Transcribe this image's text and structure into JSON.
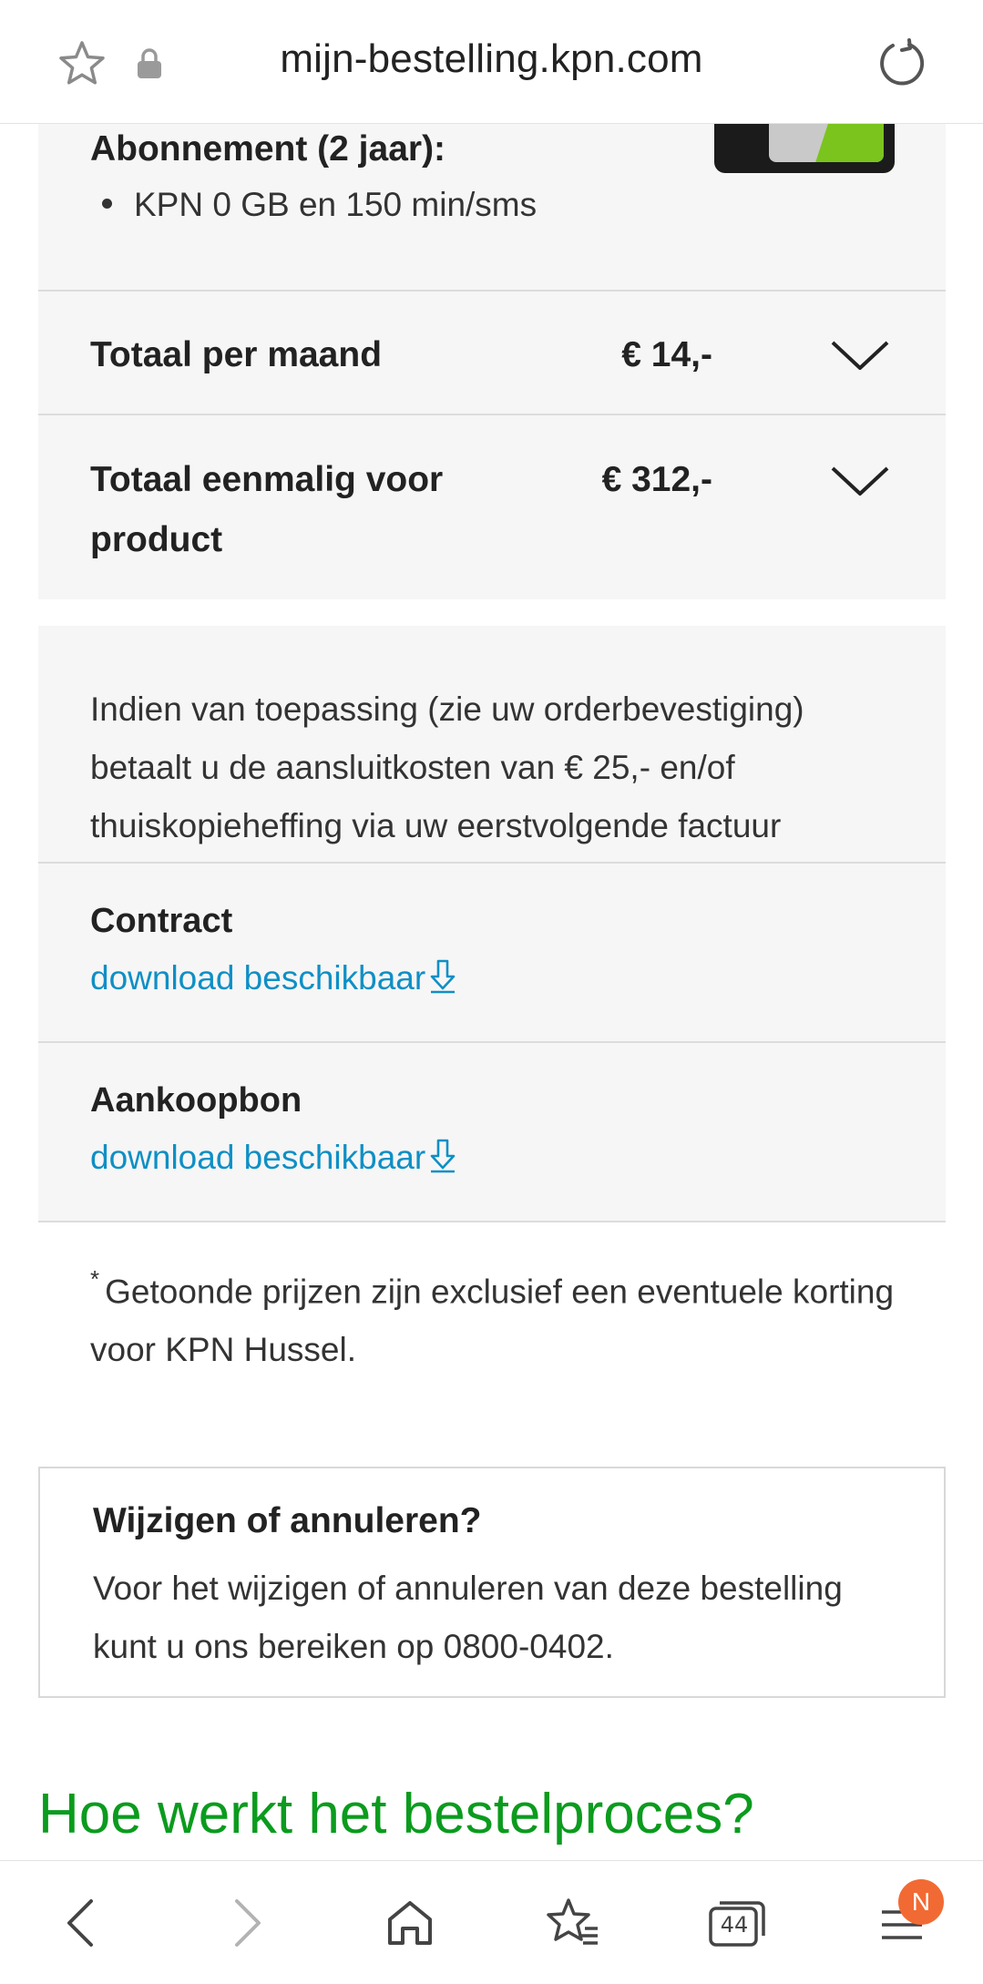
{
  "browser": {
    "url": "mijn-bestelling.kpn.com",
    "tab_count": "44",
    "menu_badge": "N"
  },
  "order": {
    "subscription_heading": "Abonnement (2 jaar):",
    "subscription_items": [
      "KPN 0 GB en 150 min/sms"
    ],
    "monthly_label": "Totaal per maand",
    "monthly_price": "€ 14,-",
    "onetime_label": "Totaal eenmalig voor product",
    "onetime_price": "€ 312,-"
  },
  "info": {
    "text": "Indien van toepassing (zie uw orderbevestiging) betaalt u de aansluitkosten van € 25,- en/of thuiskopieheffing via uw eerstvolgende factuur"
  },
  "documents": [
    {
      "title": "Contract",
      "link": "download beschikbaar"
    },
    {
      "title": "Aankoopbon",
      "link": "download beschikbaar"
    }
  ],
  "footnote": {
    "marker": "*",
    "text": "Getoonde prijzen zijn exclusief een eventuele korting voor KPN Hussel."
  },
  "change": {
    "title": "Wijzigen of annuleren?",
    "text": "Voor het wijzigen of annuleren van deze bestelling kunt u ons bereiken op 0800-0402."
  },
  "process_heading": "Hoe werkt het bestelproces?",
  "colors": {
    "link": "#0f8fc5",
    "heading_green": "#0b9b1e",
    "card_bg": "#f6f6f6",
    "badge": "#f26a33"
  },
  "icons": [
    "star-icon",
    "lock-icon",
    "reload-icon",
    "chevron-down-icon",
    "download-icon",
    "back-icon",
    "forward-icon",
    "home-icon",
    "bookmarks-icon",
    "tabs-icon",
    "menu-icon"
  ]
}
